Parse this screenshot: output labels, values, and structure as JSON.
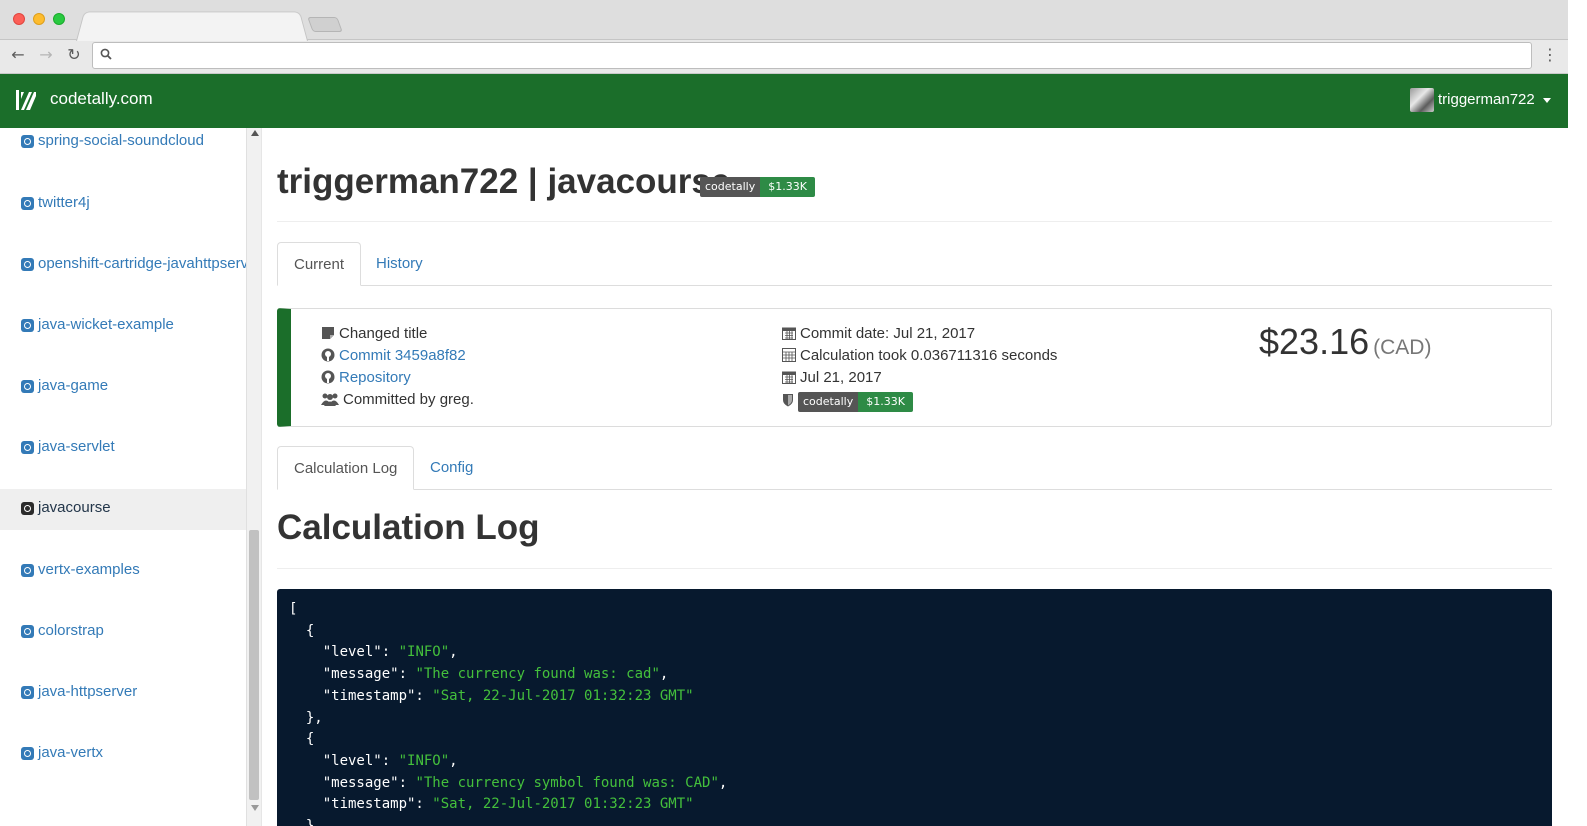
{
  "browser": {
    "address_value": "",
    "back_icon": "arrow-left-icon",
    "forward_icon": "arrow-right-icon",
    "reload_icon": "reload-icon",
    "menu_icon": "vertical-dots-icon"
  },
  "header": {
    "brand": "codetally.com",
    "user": "triggerman722",
    "color": "#1b6e2a"
  },
  "sidebar": {
    "items": [
      {
        "label": "spring-social-soundcloud",
        "active": false
      },
      {
        "label": "twitter4j",
        "active": false
      },
      {
        "label": "openshift-cartridge-javahttpserver",
        "active": false
      },
      {
        "label": "java-wicket-example",
        "active": false
      },
      {
        "label": "java-game",
        "active": false
      },
      {
        "label": "java-servlet",
        "active": false
      },
      {
        "label": "javacourse",
        "active": true
      },
      {
        "label": "vertx-examples",
        "active": false
      },
      {
        "label": "colorstrap",
        "active": false
      },
      {
        "label": "java-httpserver",
        "active": false
      },
      {
        "label": "java-vertx",
        "active": false
      }
    ]
  },
  "main": {
    "title": "triggerman722 | javacourse",
    "badge": {
      "left": "codetally",
      "right": "$1.33K"
    },
    "tabs": [
      {
        "label": "Current",
        "active": true
      },
      {
        "label": "History",
        "active": false
      }
    ],
    "commit": {
      "message": "Changed title",
      "commit_link": "Commit 3459a8f82",
      "repo_link": "Repository",
      "committed_by": "Committed by greg.",
      "commit_date": "Commit date: Jul 21, 2017",
      "calc_time": "Calculation took 0.036711316 seconds",
      "date": "Jul 21, 2017",
      "badge": {
        "left": "codetally",
        "right": "$1.33K"
      },
      "price": "$23.16",
      "currency": "(CAD)"
    },
    "subtabs": [
      {
        "label": "Calculation Log",
        "active": true
      },
      {
        "label": "Config",
        "active": false
      }
    ],
    "section_title": "Calculation Log",
    "log": [
      {
        "level": "INFO",
        "message": "The currency found was: cad",
        "timestamp": "Sat, 22-Jul-2017 01:32:23 GMT"
      },
      {
        "level": "INFO",
        "message": "The currency symbol found was: CAD",
        "timestamp": "Sat, 22-Jul-2017 01:32:23 GMT"
      }
    ]
  }
}
